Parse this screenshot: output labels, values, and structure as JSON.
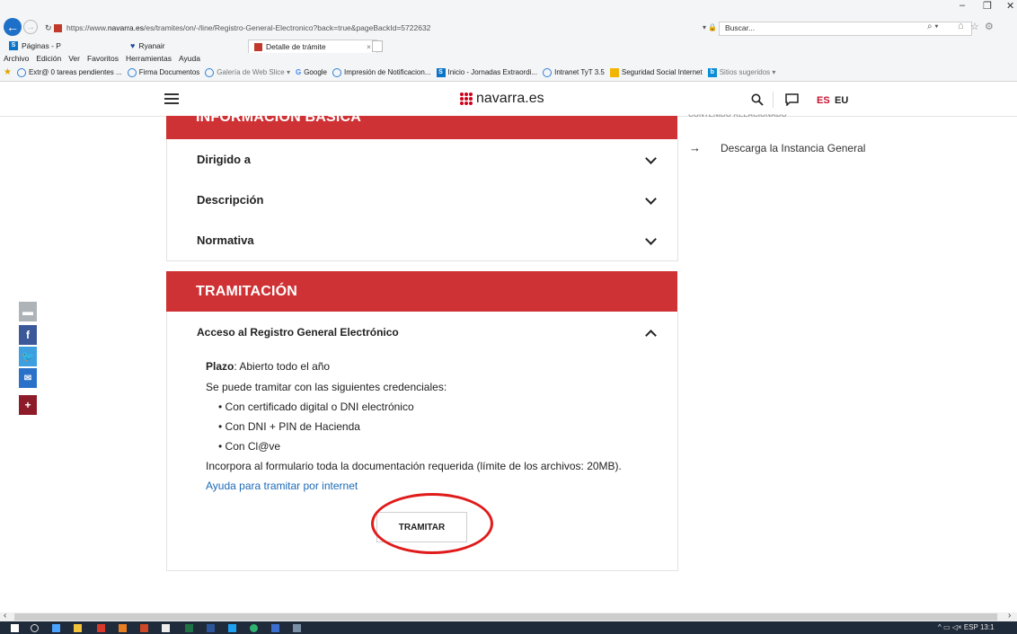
{
  "browser": {
    "url_prefix": "https://www.",
    "url_host": "navarra.es",
    "url_path": "/es/tramites/on/-/line/Registro-General-Electronico?back=true&pageBackId=5722632",
    "search_placeholder": "Buscar...",
    "tabs": [
      {
        "label": "Páginas - P"
      },
      {
        "label": "Ryanair"
      },
      {
        "label": "Detalle de trámite"
      }
    ],
    "menu": [
      "Archivo",
      "Edición",
      "Ver",
      "Favoritos",
      "Herramientas",
      "Ayuda"
    ],
    "favorites": [
      "Extr@ 0 tareas pendientes ...",
      "Firma Documentos",
      "Galería de Web Slice ▾",
      "Google",
      "Impresión de Notificacion...",
      "Inicio - Jornadas Extraordi...",
      "Intranet TyT 3.5",
      "Seguridad Social Internet",
      "Sitios sugeridos ▾"
    ]
  },
  "site": {
    "logo_text": "navarra.es",
    "lang_es": "ES",
    "lang_eu": "EU"
  },
  "info": {
    "heading": "INFORMACIÓN BÁSICA",
    "rows": [
      "Dirigido a",
      "Descripción",
      "Normativa"
    ]
  },
  "tramitacion": {
    "heading": "TRAMITACIÓN",
    "access_title": "Acceso al Registro General Electrónico",
    "plazo_label": "Plazo",
    "plazo_value": ": Abierto todo el año",
    "credentials_intro": "Se puede tramitar con las siguientes credenciales:",
    "credentials": [
      "Con certificado digital o DNI electrónico",
      "Con DNI + PIN de Hacienda",
      "Con Cl@ve"
    ],
    "docs_note": "Incorpora al formulario toda la documentación requerida (límite de los archivos: 20MB).",
    "help_link": "Ayuda para tramitar por internet",
    "button": "TRAMITAR"
  },
  "related": {
    "heading": "CONTENIDO RELACIONADO",
    "links": [
      "Descarga la Instancia General"
    ]
  },
  "taskbar": {
    "lang": "ESP",
    "time": "13:1"
  },
  "colors": {
    "brand_red": "#cf3234",
    "link_blue": "#1b6ab8",
    "annotation_red": "#e01b1b"
  }
}
